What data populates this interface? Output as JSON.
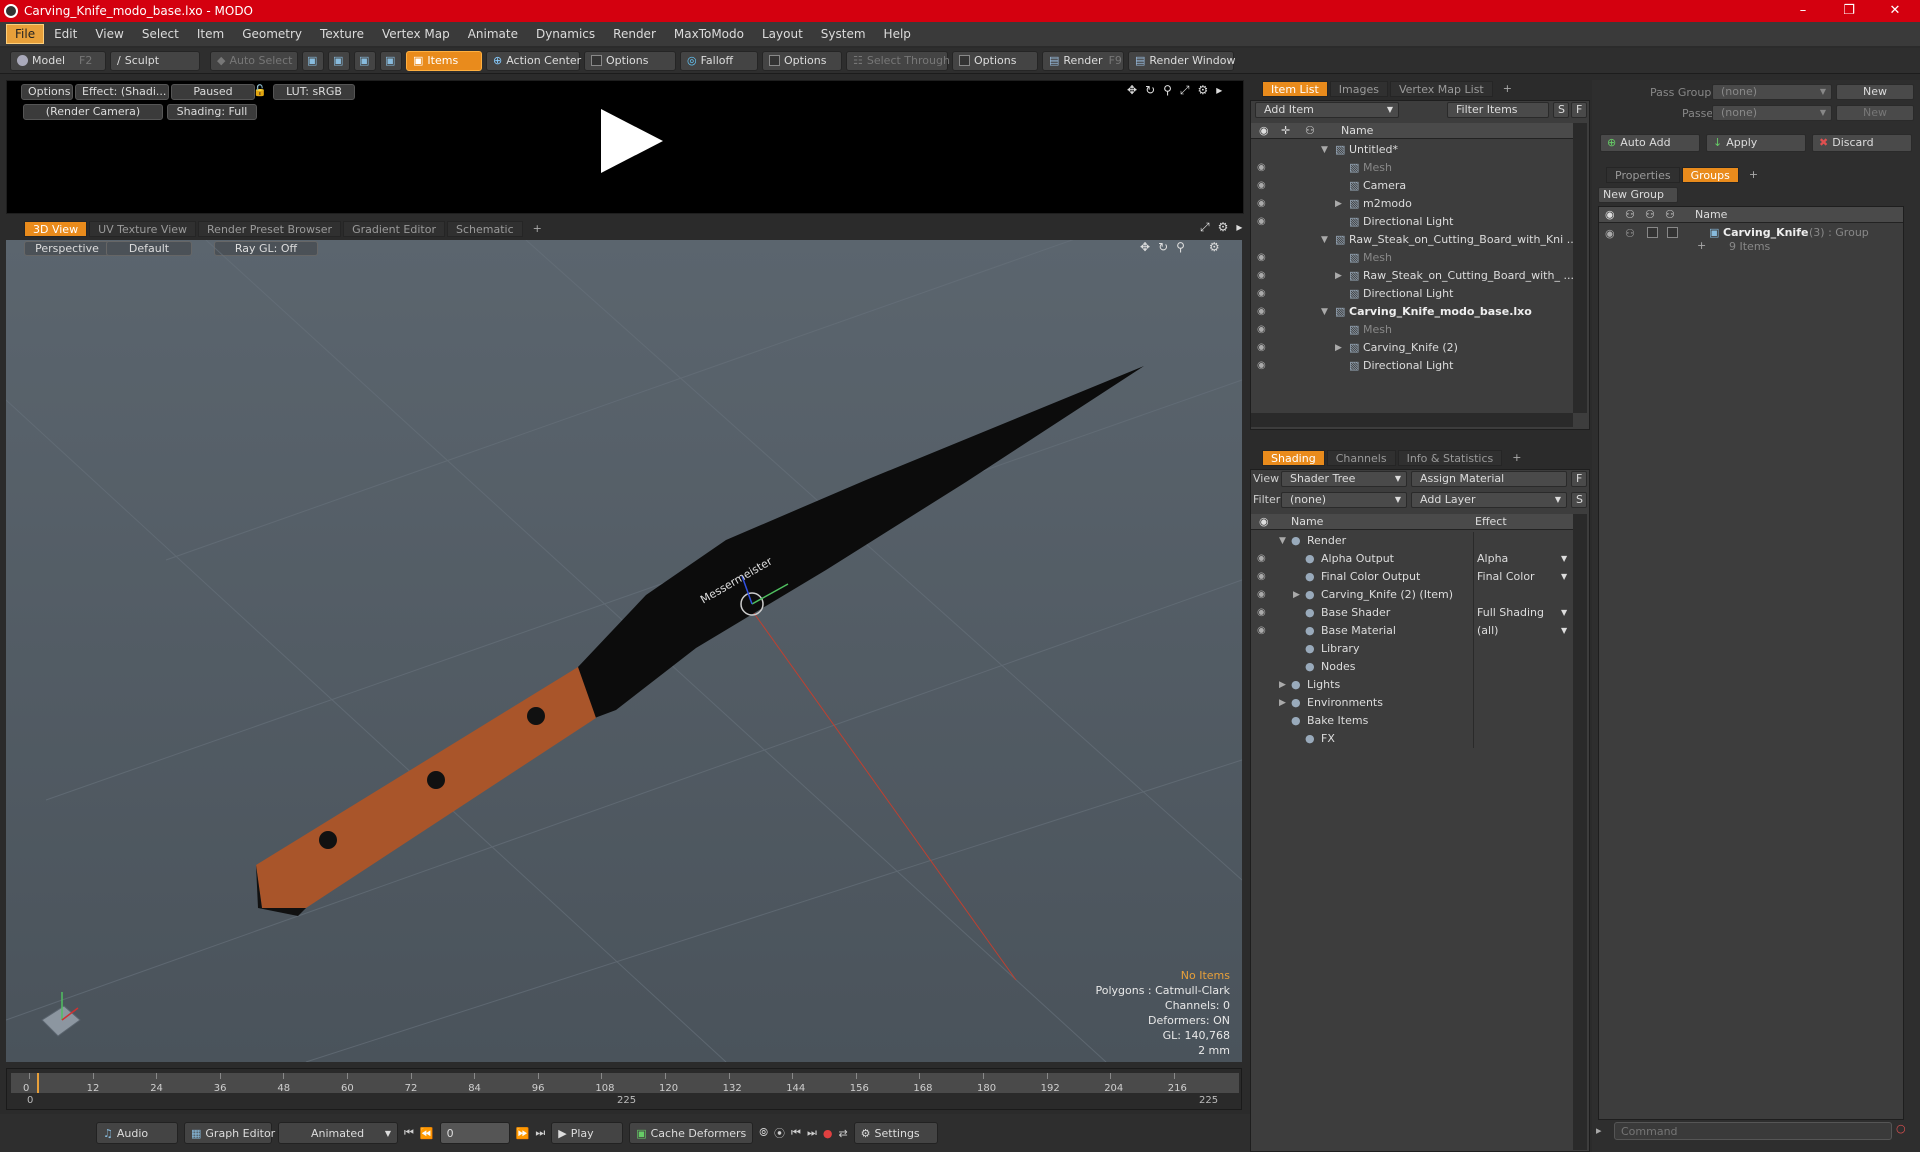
{
  "window": {
    "title": "Carving_Knife_modo_base.lxo - MODO",
    "minimize": "–",
    "maximize": "❐",
    "close": "✕"
  },
  "menu": [
    "File",
    "Edit",
    "View",
    "Select",
    "Item",
    "Geometry",
    "Texture",
    "Vertex Map",
    "Animate",
    "Dynamics",
    "Render",
    "MaxToModo",
    "Layout",
    "System",
    "Help"
  ],
  "toolbar": {
    "model": "Model",
    "model_key": "F2",
    "sculpt": "Sculpt",
    "auto_select": "Auto Select",
    "items": "Items",
    "action_center": "Action Center",
    "options1": "Options",
    "falloff": "Falloff",
    "options2": "Options",
    "select_through": "Select Through",
    "options3": "Options",
    "render": "Render",
    "render_key": "F9",
    "render_window": "Render Window"
  },
  "preview": {
    "options": "Options",
    "effect": "Effect: (Shadi...",
    "paused": "Paused",
    "lut": "LUT: sRGB",
    "camera": "(Render Camera)",
    "shading": "Shading: Full"
  },
  "view_tabs": [
    "3D View",
    "UV Texture View",
    "Render Preset Browser",
    "Gradient Editor",
    "Schematic",
    "+"
  ],
  "viewport": {
    "perspective": "Perspective",
    "default": "Default",
    "raygl": "Ray GL: Off",
    "knife_text": "Messermeister",
    "stats": {
      "no_items": "No Items",
      "polygons": "Polygons : Catmull-Clark",
      "channels": "Channels: 0",
      "deformers": "Deformers: ON",
      "gl": "GL: 140,768",
      "scale": "2 mm"
    }
  },
  "timeline": {
    "ticks": [
      "0",
      "12",
      "24",
      "36",
      "48",
      "60",
      "72",
      "84",
      "96",
      "108",
      "120",
      "132",
      "144",
      "156",
      "168",
      "180",
      "192",
      "204",
      "216"
    ],
    "start": "0",
    "mid": "225",
    "end": "225"
  },
  "bottom": {
    "audio": "Audio",
    "graph_editor": "Graph Editor",
    "animated": "Animated",
    "frame": "0",
    "play": "Play",
    "cache": "Cache Deformers",
    "settings": "Settings"
  },
  "item_list": {
    "tabs": [
      "Item List",
      "Images",
      "Vertex Map List",
      "+"
    ],
    "add_item": "Add Item",
    "filter": "Filter Items",
    "s": "S",
    "f": "F",
    "name_header": "Name",
    "rows": [
      {
        "label": "Untitled*",
        "indent": 0,
        "exp": "▼",
        "eye": false,
        "gray": false,
        "bold": false
      },
      {
        "label": "Mesh",
        "indent": 1,
        "exp": "",
        "eye": true,
        "gray": true,
        "bold": false
      },
      {
        "label": "Camera",
        "indent": 1,
        "exp": "",
        "eye": true,
        "gray": false,
        "bold": false
      },
      {
        "label": "m2modo",
        "indent": 1,
        "exp": "▶",
        "eye": true,
        "gray": false,
        "bold": false
      },
      {
        "label": "Directional Light",
        "indent": 1,
        "exp": "",
        "eye": true,
        "gray": false,
        "bold": false
      },
      {
        "label": "Raw_Steak_on_Cutting_Board_with_Kni ...",
        "indent": 0,
        "exp": "▼",
        "eye": false,
        "gray": false,
        "bold": false
      },
      {
        "label": "Mesh",
        "indent": 1,
        "exp": "",
        "eye": true,
        "gray": true,
        "bold": false
      },
      {
        "label": "Raw_Steak_on_Cutting_Board_with_ ...",
        "indent": 1,
        "exp": "▶",
        "eye": true,
        "gray": false,
        "bold": false
      },
      {
        "label": "Directional Light",
        "indent": 1,
        "exp": "",
        "eye": true,
        "gray": false,
        "bold": false
      },
      {
        "label": "Carving_Knife_modo_base.lxo",
        "indent": 0,
        "exp": "▼",
        "eye": true,
        "gray": false,
        "bold": true
      },
      {
        "label": "Mesh",
        "indent": 1,
        "exp": "",
        "eye": true,
        "gray": true,
        "bold": false
      },
      {
        "label": "Carving_Knife (2)",
        "indent": 1,
        "exp": "▶",
        "eye": true,
        "gray": false,
        "bold": false
      },
      {
        "label": "Directional Light",
        "indent": 1,
        "exp": "",
        "eye": true,
        "gray": false,
        "bold": false
      }
    ]
  },
  "shading": {
    "tabs": [
      "Shading",
      "Channels",
      "Info & Statistics",
      "+"
    ],
    "view_label": "View",
    "view_value": "Shader Tree",
    "assign": "Assign Material",
    "f": "F",
    "filter_label": "Filter",
    "filter_value": "(none)",
    "add_layer": "Add Layer",
    "s": "S",
    "name_header": "Name",
    "effect_header": "Effect",
    "rows": [
      {
        "label": "Render",
        "effect": "",
        "indent": 0,
        "exp": "▼",
        "eye": false
      },
      {
        "label": "Alpha Output",
        "effect": "Alpha",
        "indent": 1,
        "exp": "",
        "eye": true
      },
      {
        "label": "Final Color Output",
        "effect": "Final Color",
        "indent": 1,
        "exp": "",
        "eye": true
      },
      {
        "label": "Carving_Knife (2) (Item)",
        "effect": "",
        "indent": 1,
        "exp": "▶",
        "eye": true
      },
      {
        "label": "Base Shader",
        "effect": "Full Shading",
        "indent": 1,
        "exp": "",
        "eye": true
      },
      {
        "label": "Base Material",
        "effect": "(all)",
        "indent": 1,
        "exp": "",
        "eye": true
      },
      {
        "label": "Library",
        "effect": "",
        "indent": 1,
        "exp": "",
        "eye": false
      },
      {
        "label": "Nodes",
        "effect": "",
        "indent": 1,
        "exp": "",
        "eye": false
      },
      {
        "label": "Lights",
        "effect": "",
        "indent": 0,
        "exp": "▶",
        "eye": false
      },
      {
        "label": "Environments",
        "effect": "",
        "indent": 0,
        "exp": "▶",
        "eye": false
      },
      {
        "label": "Bake Items",
        "effect": "",
        "indent": 0,
        "exp": "",
        "eye": false
      },
      {
        "label": "FX",
        "effect": "",
        "indent": 1,
        "exp": "",
        "eye": false
      }
    ]
  },
  "groups": {
    "pass_groups_label": "Pass Groups",
    "pass_groups_value": "(none)",
    "new1": "New",
    "passes_label": "Passes",
    "passes_value": "(none)",
    "new2": "New",
    "auto_add": "Auto Add",
    "apply": "Apply",
    "discard": "Discard",
    "tabs": [
      "Properties",
      "Groups",
      "+"
    ],
    "new_group": "New Group",
    "name_header": "Name",
    "item_name": "Carving_Knife",
    "item_meta": "(3) : Group",
    "item_count": "9 Items",
    "command_placeholder": "Command"
  }
}
